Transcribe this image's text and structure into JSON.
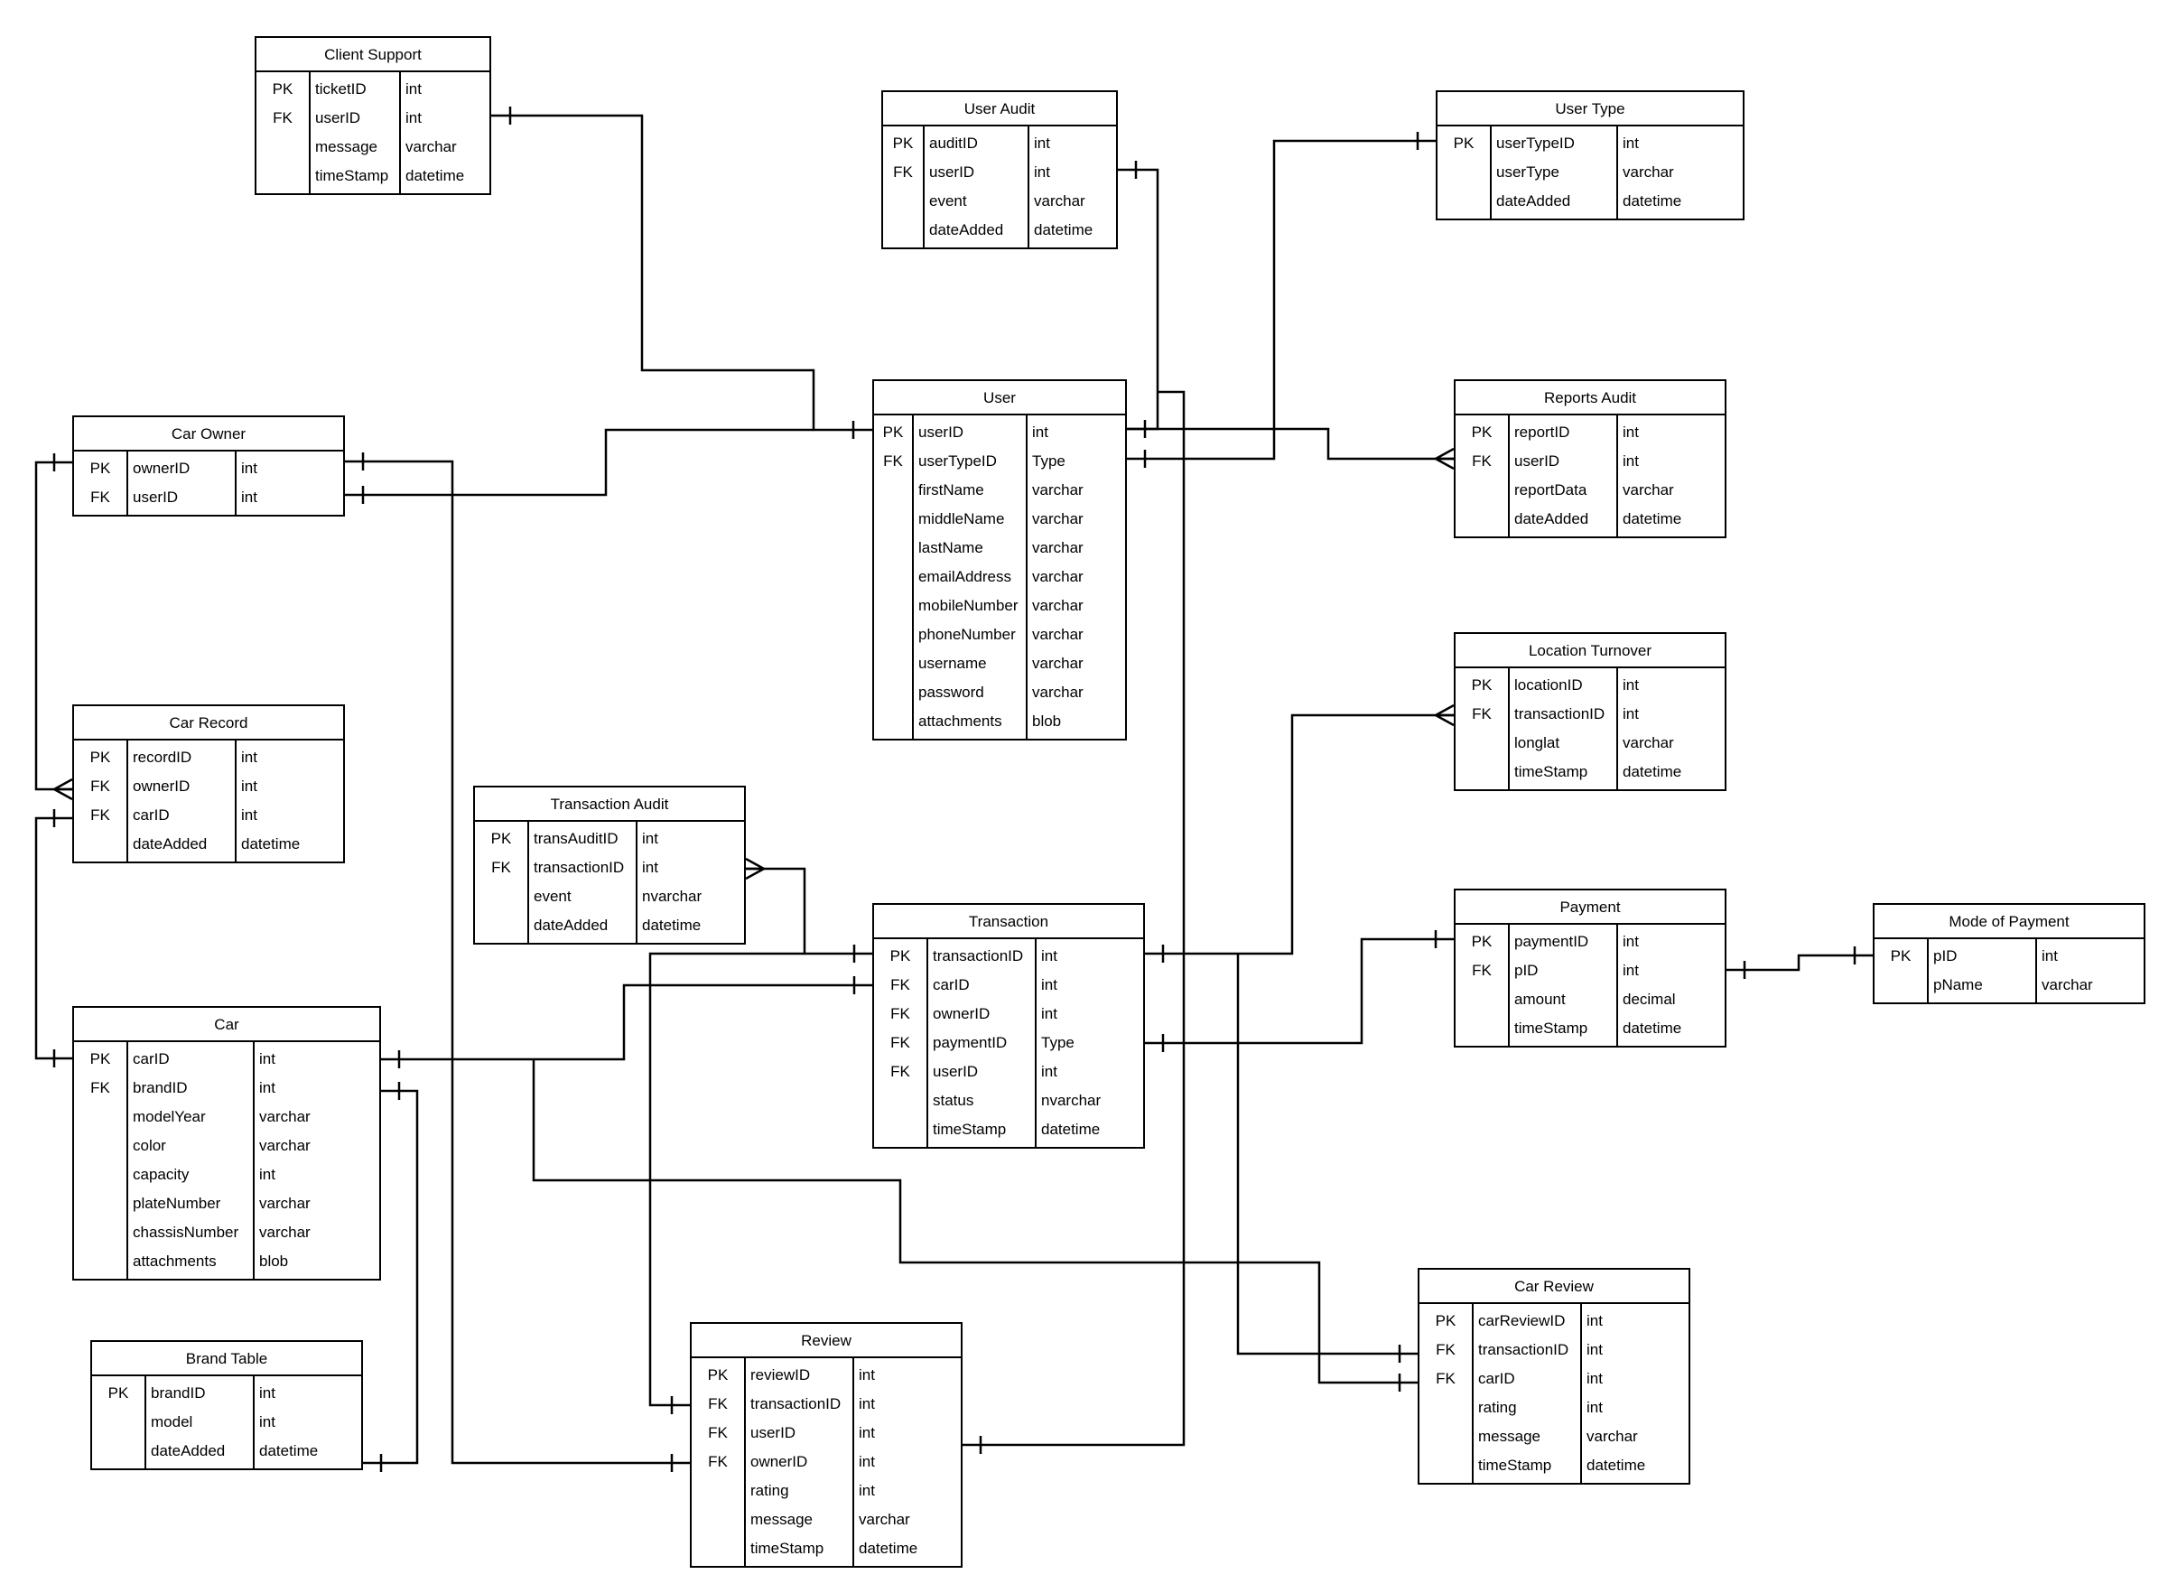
{
  "diagram": {
    "type": "Entity Relationship Diagram",
    "entities": [
      {
        "id": "client-support",
        "title": "Client Support",
        "columns": [
          [
            "PK",
            "ticketID",
            "int"
          ],
          [
            "FK",
            "userID",
            "int"
          ],
          [
            "",
            "message",
            "varchar"
          ],
          [
            "",
            "timeStamp",
            "datetime"
          ]
        ]
      },
      {
        "id": "user-audit",
        "title": "User Audit",
        "columns": [
          [
            "PK",
            "auditID",
            "int"
          ],
          [
            "FK",
            "userID",
            "int"
          ],
          [
            "",
            "event",
            "varchar"
          ],
          [
            "",
            "dateAdded",
            "datetime"
          ]
        ]
      },
      {
        "id": "user-type",
        "title": "User Type",
        "columns": [
          [
            "PK",
            "userTypeID",
            "int"
          ],
          [
            "",
            "userType",
            "varchar"
          ],
          [
            "",
            "dateAdded",
            "datetime"
          ]
        ]
      },
      {
        "id": "user",
        "title": "User",
        "columns": [
          [
            "PK",
            "userID",
            "int"
          ],
          [
            "FK",
            "userTypeID",
            "Type"
          ],
          [
            "",
            "firstName",
            "varchar"
          ],
          [
            "",
            "middleName",
            "varchar"
          ],
          [
            "",
            "lastName",
            "varchar"
          ],
          [
            "",
            "emailAddress",
            "varchar"
          ],
          [
            "",
            "mobileNumber",
            "varchar"
          ],
          [
            "",
            "phoneNumber",
            "varchar"
          ],
          [
            "",
            "username",
            "varchar"
          ],
          [
            "",
            "password",
            "varchar"
          ],
          [
            "",
            "attachments",
            "blob"
          ]
        ]
      },
      {
        "id": "reports-audit",
        "title": "Reports Audit",
        "columns": [
          [
            "PK",
            "reportID",
            "int"
          ],
          [
            "FK",
            "userID",
            "int"
          ],
          [
            "",
            "reportData",
            "varchar"
          ],
          [
            "",
            "dateAdded",
            "datetime"
          ]
        ]
      },
      {
        "id": "car-owner",
        "title": "Car Owner",
        "columns": [
          [
            "PK",
            "ownerID",
            "int"
          ],
          [
            "FK",
            "userID",
            "int"
          ]
        ]
      },
      {
        "id": "car-record",
        "title": "Car Record",
        "columns": [
          [
            "PK",
            "recordID",
            "int"
          ],
          [
            "FK",
            "ownerID",
            "int"
          ],
          [
            "FK",
            "carID",
            "int"
          ],
          [
            "",
            "dateAdded",
            "datetime"
          ]
        ]
      },
      {
        "id": "location-turnover",
        "title": "Location Turnover",
        "columns": [
          [
            "PK",
            "locationID",
            "int"
          ],
          [
            "FK",
            "transactionID",
            "int"
          ],
          [
            "",
            "longlat",
            "varchar"
          ],
          [
            "",
            "timeStamp",
            "datetime"
          ]
        ]
      },
      {
        "id": "transaction-audit",
        "title": "Transaction Audit",
        "columns": [
          [
            "PK",
            "transAuditID",
            "int"
          ],
          [
            "FK",
            "transactionID",
            "int"
          ],
          [
            "",
            "event",
            "nvarchar"
          ],
          [
            "",
            "dateAdded",
            "datetime"
          ]
        ]
      },
      {
        "id": "transaction",
        "title": "Transaction",
        "columns": [
          [
            "PK",
            "transactionID",
            "int"
          ],
          [
            "FK",
            "carID",
            "int"
          ],
          [
            "FK",
            "ownerID",
            "int"
          ],
          [
            "FK",
            "paymentID",
            "Type"
          ],
          [
            "FK",
            "userID",
            "int"
          ],
          [
            "",
            "status",
            "nvarchar"
          ],
          [
            "",
            "timeStamp",
            "datetime"
          ]
        ]
      },
      {
        "id": "payment",
        "title": "Payment",
        "columns": [
          [
            "PK",
            "paymentID",
            "int"
          ],
          [
            "FK",
            "pID",
            "int"
          ],
          [
            "",
            "amount",
            "decimal"
          ],
          [
            "",
            "timeStamp",
            "datetime"
          ]
        ]
      },
      {
        "id": "mode-of-payment",
        "title": "Mode of Payment",
        "columns": [
          [
            "PK",
            "pID",
            "int"
          ],
          [
            "",
            "pName",
            "varchar"
          ]
        ]
      },
      {
        "id": "car",
        "title": "Car",
        "columns": [
          [
            "PK",
            "carID",
            "int"
          ],
          [
            "FK",
            "brandID",
            "int"
          ],
          [
            "",
            "modelYear",
            "varchar"
          ],
          [
            "",
            "color",
            "varchar"
          ],
          [
            "",
            "capacity",
            "int"
          ],
          [
            "",
            "plateNumber",
            "varchar"
          ],
          [
            "",
            "chassisNumber",
            "varchar"
          ],
          [
            "",
            "attachments",
            "blob"
          ]
        ]
      },
      {
        "id": "car-review",
        "title": "Car Review",
        "columns": [
          [
            "PK",
            "carReviewID",
            "int"
          ],
          [
            "FK",
            "transactionID",
            "int"
          ],
          [
            "FK",
            "carID",
            "int"
          ],
          [
            "",
            "rating",
            "int"
          ],
          [
            "",
            "message",
            "varchar"
          ],
          [
            "",
            "timeStamp",
            "datetime"
          ]
        ]
      },
      {
        "id": "review",
        "title": "Review",
        "columns": [
          [
            "PK",
            "reviewID",
            "int"
          ],
          [
            "FK",
            "transactionID",
            "int"
          ],
          [
            "FK",
            "userID",
            "int"
          ],
          [
            "FK",
            "ownerID",
            "int"
          ],
          [
            "",
            "rating",
            "int"
          ],
          [
            "",
            "message",
            "varchar"
          ],
          [
            "",
            "timeStamp",
            "datetime"
          ]
        ]
      },
      {
        "id": "brand-table",
        "title": "Brand Table",
        "columns": [
          [
            "PK",
            "brandID",
            "int"
          ],
          [
            "",
            "model",
            "int"
          ],
          [
            "",
            "dateAdded",
            "datetime"
          ]
        ]
      }
    ],
    "relationships": [
      {
        "from": "client-support.userID",
        "to": "user.userID",
        "from_end": "one",
        "to_end": "one"
      },
      {
        "from": "user-audit.userID",
        "to": "user.userID",
        "from_end": "one",
        "to_end": "one"
      },
      {
        "from": "user.userTypeID",
        "to": "user-type.userTypeID",
        "from_end": "one",
        "to_end": "one"
      },
      {
        "from": "user.userID",
        "to": "reports-audit.userID",
        "from_end": "one",
        "to_end": "many"
      },
      {
        "from": "car-owner.userID",
        "to": "user.userID",
        "from_end": "one",
        "to_end": "one"
      },
      {
        "from": "car-owner.ownerID",
        "to": "car-record.ownerID",
        "from_end": "one",
        "to_end": "many"
      },
      {
        "from": "car-owner.ownerID",
        "to": "review.ownerID",
        "from_end": "one",
        "to_end": "one"
      },
      {
        "from": "car.carID",
        "to": "car-record.carID",
        "from_end": "one",
        "to_end": "one"
      },
      {
        "from": "car.carID",
        "to": "transaction.carID",
        "from_end": "one",
        "to_end": "one"
      },
      {
        "from": "car.carID",
        "to": "car-review.carID",
        "from_end": "one",
        "to_end": "one"
      },
      {
        "from": "car.brandID",
        "to": "brand-table.brandID",
        "from_end": "one",
        "to_end": "one"
      },
      {
        "from": "transaction.transactionID",
        "to": "transaction-audit.transactionID",
        "from_end": "one",
        "to_end": "many"
      },
      {
        "from": "transaction.transactionID",
        "to": "location-turnover.transactionID",
        "from_end": "one",
        "to_end": "many"
      },
      {
        "from": "transaction.transactionID",
        "to": "review.transactionID",
        "from_end": "one",
        "to_end": "one"
      },
      {
        "from": "transaction.transactionID",
        "to": "car-review.transactionID",
        "from_end": "one",
        "to_end": "one"
      },
      {
        "from": "transaction.paymentID",
        "to": "payment.paymentID",
        "from_end": "one",
        "to_end": "one"
      },
      {
        "from": "payment.pID",
        "to": "mode-of-payment.pID",
        "from_end": "one",
        "to_end": "one"
      },
      {
        "from": "user.userID",
        "to": "review.userID",
        "from_end": "one",
        "to_end": "one"
      }
    ]
  }
}
